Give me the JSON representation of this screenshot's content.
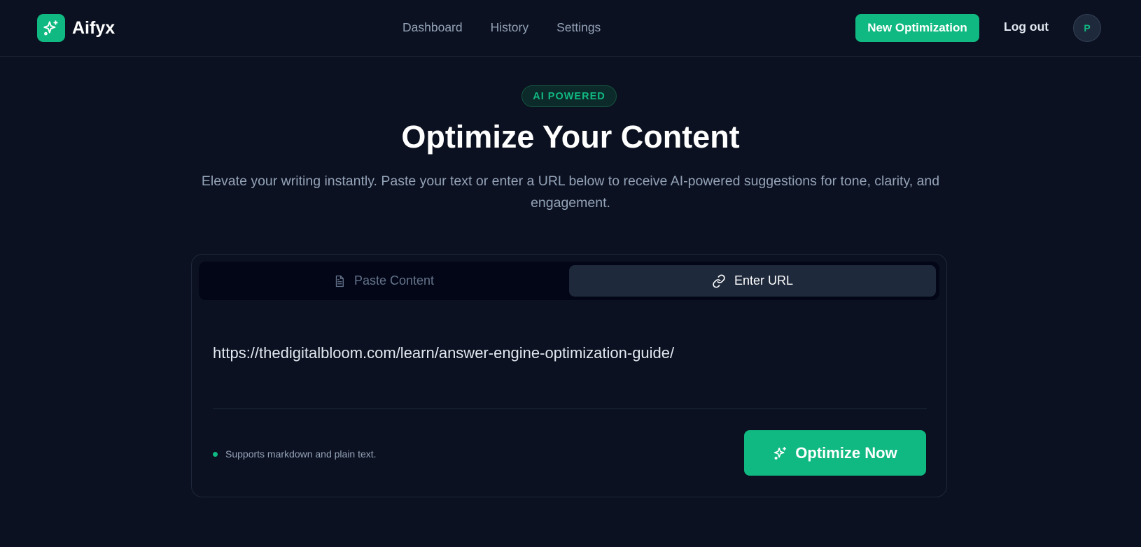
{
  "brand": {
    "name": "Aifyx",
    "logo_icon": "sparkles-icon"
  },
  "nav": {
    "links": [
      {
        "label": "Dashboard"
      },
      {
        "label": "History"
      },
      {
        "label": "Settings"
      }
    ],
    "new_optimization_label": "New Optimization",
    "logout_label": "Log out",
    "avatar_initial": "P"
  },
  "hero": {
    "badge": "AI POWERED",
    "title": "Optimize Your Content",
    "subtitle": "Elevate your writing instantly. Paste your text or enter a URL below to receive AI-powered suggestions for tone, clarity, and engagement."
  },
  "card": {
    "tabs": [
      {
        "label": "Paste Content",
        "icon": "document-icon",
        "active": false
      },
      {
        "label": "Enter URL",
        "icon": "link-icon",
        "active": true
      }
    ],
    "url_value": "https://thedigitalbloom.com/learn/answer-engine-optimization-guide/",
    "hint": "Supports markdown and plain text.",
    "optimize_label": "Optimize Now"
  },
  "colors": {
    "background": "#0b1120",
    "accent": "#10b981",
    "muted_text": "#94a3b8",
    "active_tab": "#1e293b"
  }
}
